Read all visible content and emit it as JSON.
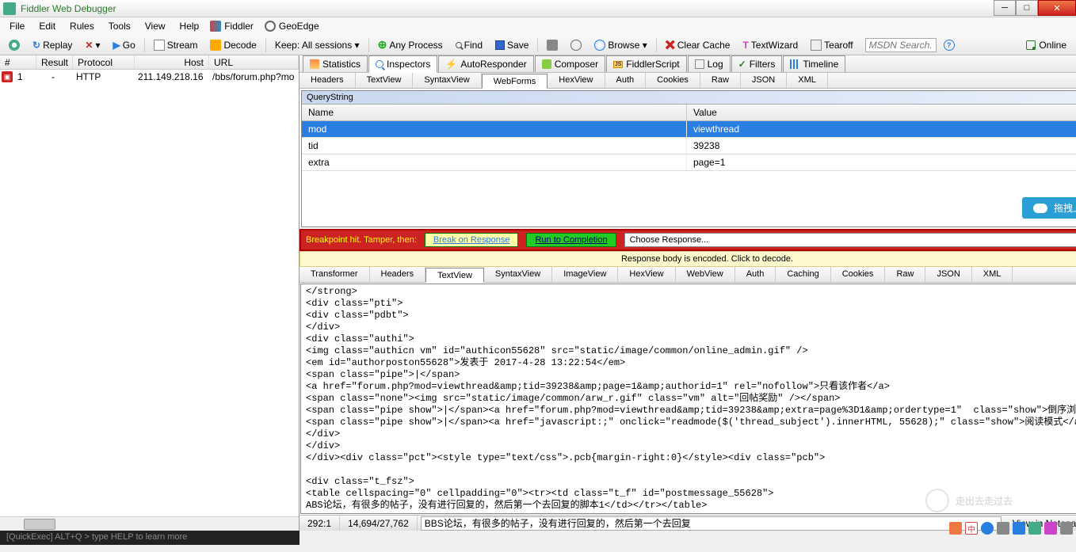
{
  "app": {
    "title": "Fiddler Web Debugger"
  },
  "menu": {
    "file": "File",
    "edit": "Edit",
    "rules": "Rules",
    "tools": "Tools",
    "view": "View",
    "help": "Help",
    "fiddler": "Fiddler",
    "geoedge": "GeoEdge"
  },
  "toolbar": {
    "replay": "Replay",
    "go": "Go",
    "stream": "Stream",
    "decode": "Decode",
    "keep": "Keep: All sessions ▾",
    "any": "Any Process",
    "find": "Find",
    "save": "Save",
    "browse": "Browse ▾",
    "clear": "Clear Cache",
    "wizard": "TextWizard",
    "tearoff": "Tearoff",
    "search_ph": "MSDN Search...",
    "online": "Online"
  },
  "sessions": {
    "cols": {
      "num": "#",
      "result": "Result",
      "protocol": "Protocol",
      "host": "Host",
      "url": "URL"
    },
    "rows": [
      {
        "num": "1",
        "result": "-",
        "protocol": "HTTP",
        "host": "211.149.218.16",
        "url": "/bbs/forum.php?mo"
      }
    ]
  },
  "main_tabs": {
    "stats": "Statistics",
    "insp": "Inspectors",
    "auto": "AutoResponder",
    "comp": "Composer",
    "fs": "FiddlerScript",
    "log": "Log",
    "filt": "Filters",
    "tl": "Timeline"
  },
  "req_tabs": {
    "headers": "Headers",
    "textview": "TextView",
    "syntax": "SyntaxView",
    "webforms": "WebForms",
    "hex": "HexView",
    "auth": "Auth",
    "cookies": "Cookies",
    "raw": "Raw",
    "json": "JSON",
    "xml": "XML"
  },
  "qs": {
    "title": "QueryString",
    "name_col": "Name",
    "value_col": "Value",
    "rows": [
      {
        "name": "mod",
        "value": "viewthread"
      },
      {
        "name": "tid",
        "value": "39238"
      },
      {
        "name": "extra",
        "value": "page=1"
      }
    ],
    "upload": "拖拽上传"
  },
  "bp": {
    "text": "Breakpoint hit. Tamper, then:",
    "break": "Break on Response",
    "run": "Run to Completion",
    "choose": "Choose Response..."
  },
  "encoded": "Response body is encoded. Click to decode.",
  "resp_tabs": {
    "trans": "Transformer",
    "headers": "Headers",
    "textview": "TextView",
    "syntax": "SyntaxView",
    "image": "ImageView",
    "hex": "HexView",
    "web": "WebView",
    "auth": "Auth",
    "caching": "Caching",
    "cookies": "Cookies",
    "raw": "Raw",
    "json": "JSON",
    "xml": "XML"
  },
  "resp_body": "</strong>\n<div class=\"pti\">\n<div class=\"pdbt\">\n</div>\n<div class=\"authi\">\n<img class=\"authicn vm\" id=\"authicon55628\" src=\"static/image/common/online_admin.gif\" />\n<em id=\"authorposton55628\">发表于 2017-4-28 13:22:54</em>\n<span class=\"pipe\">|</span>\n<a href=\"forum.php?mod=viewthread&amp;tid=39238&amp;page=1&amp;authorid=1\" rel=\"nofollow\">只看该作者</a>\n<span class=\"none\"><img src=\"static/image/common/arw_r.gif\" class=\"vm\" alt=\"回帖奖励\" /></span>\n<span class=\"pipe show\">|</span><a href=\"forum.php?mod=viewthread&amp;tid=39238&amp;extra=page%3D1&amp;ordertype=1\"  class=\"show\">倒序浏览</a>\n<span class=\"pipe show\">|</span><a href=\"javascript:;\" onclick=\"readmode($('thread_subject').innerHTML, 55628);\" class=\"show\">阅读模式</a>\n</div>\n</div>\n</div><div class=\"pct\"><style type=\"text/css\">.pcb{margin-right:0}</style><div class=\"pcb\">\n\n<div class=\"t_fsz\">\n<table cellspacing=\"0\" cellpadding=\"0\"><tr><td class=\"t_f\" id=\"postmessage_55628\">\nABS论坛，有很多的帖子，没有进行回复的，然后第一个去回复的脚本1</td></tr></table>",
  "status": {
    "pos": "292:1",
    "bytes": "14,694/27,762",
    "sel": "BBS论坛，有很多的帖子，没有进行回复的，然后第一个去回复",
    "notepad": "View in Notepad",
    "more": "..."
  },
  "quickexec": "[QuickExec] ALT+Q > type HELP to learn more",
  "watermark": "走出去走过去"
}
